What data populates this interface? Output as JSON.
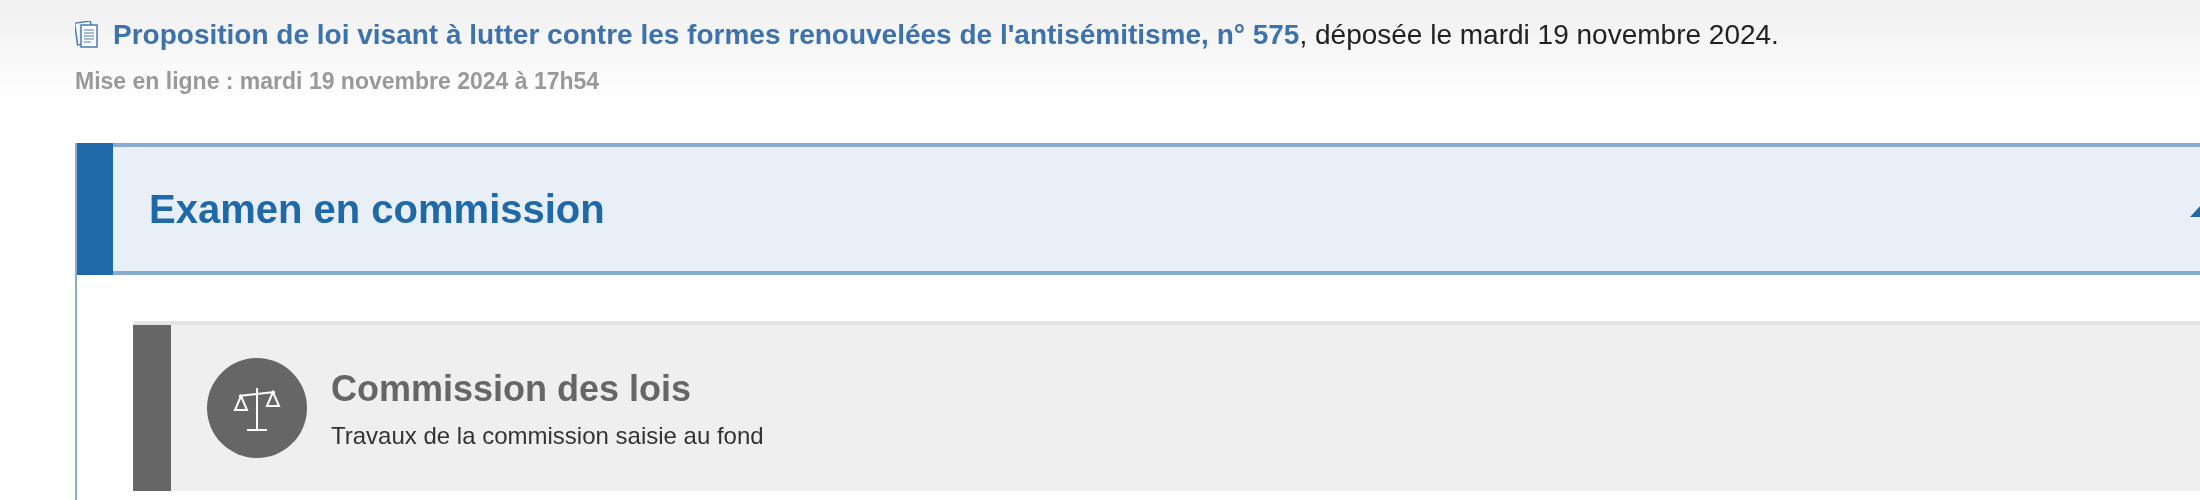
{
  "document": {
    "link": "Proposition de loi visant à lutter contre les formes renouvelées de l'antisémitisme, n° 575",
    "suffix": ", déposée le mardi 19 novembre 2024.",
    "published": "Mise en ligne : mardi 19 novembre 2024 à 17h54"
  },
  "section": {
    "title": "Examen en commission",
    "expanded": true,
    "cards": [
      {
        "title": "Commission des lois",
        "subtitle": "Travaux de la commission saisie au fond"
      }
    ]
  }
}
